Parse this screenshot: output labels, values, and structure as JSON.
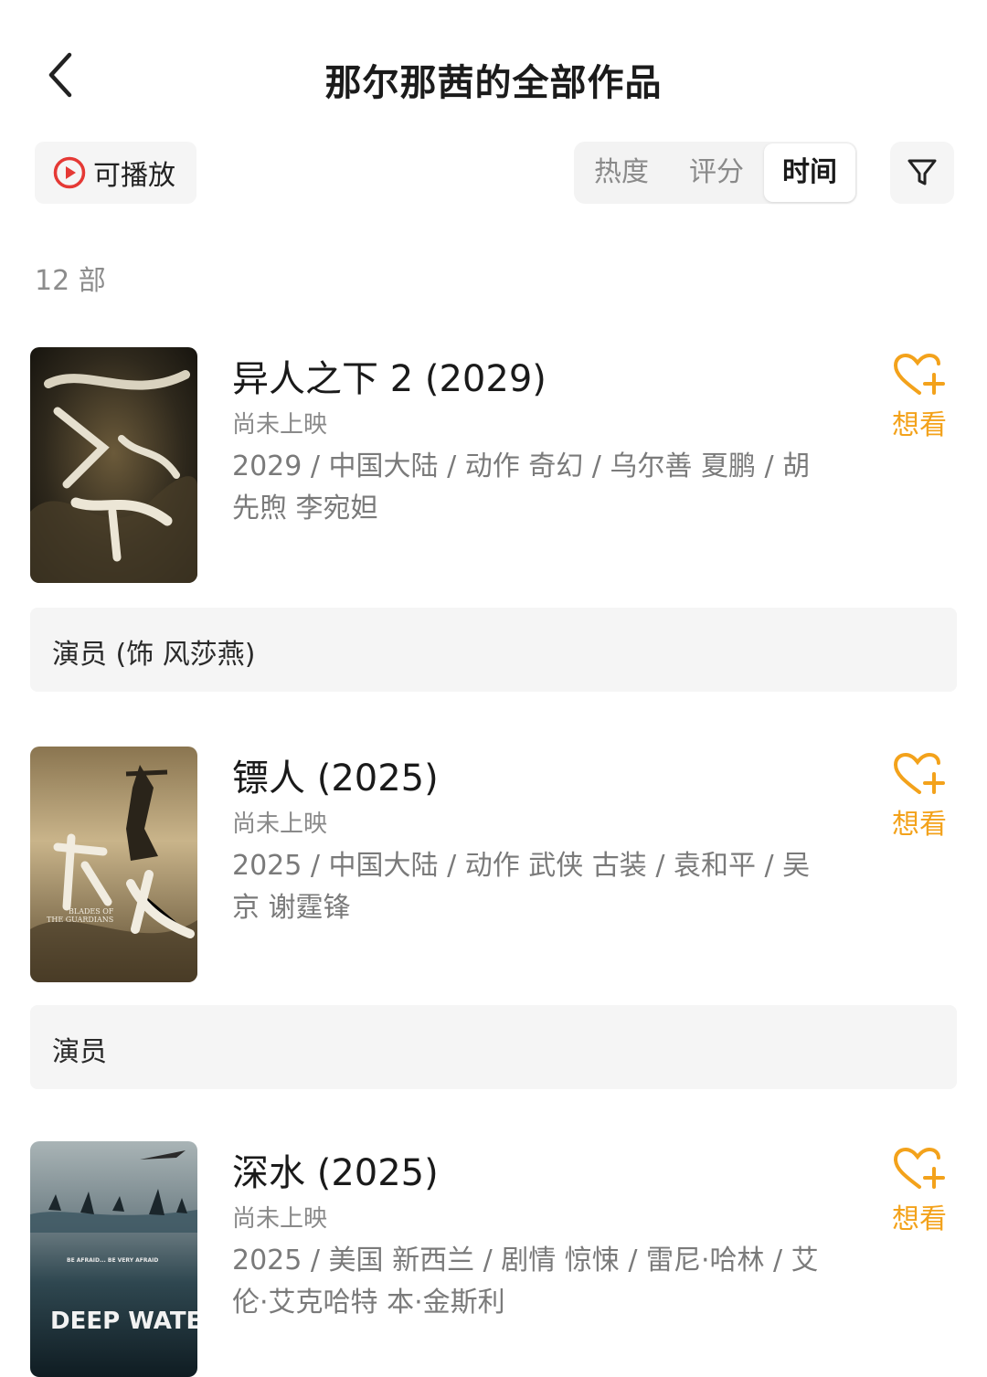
{
  "header": {
    "title": "那尔那茜的全部作品",
    "back_icon": "chevron-left-icon"
  },
  "filters": {
    "playable_label": "可播放",
    "playable_icon": "play-circle-icon",
    "sort_tabs": [
      {
        "label": "热度",
        "active": false
      },
      {
        "label": "评分",
        "active": false
      },
      {
        "label": "时间",
        "active": true
      }
    ],
    "filter_icon": "funnel-icon"
  },
  "count": "12 部",
  "colors": {
    "accent": "#f3a21b",
    "play_red": "#e53935"
  },
  "works": [
    {
      "title": "异人之下 2 (2029)",
      "status": "尚未上映",
      "meta": "2029 / 中国大陆 / 动作 奇幻 / 乌尔善 夏鹏 / 胡先煦 李宛妲",
      "wish_label": "想看",
      "wish_icon": "heart-plus-icon",
      "role": "演员 (饰 风莎燕)"
    },
    {
      "title": "镖人 (2025)",
      "status": "尚未上映",
      "meta": "2025 / 中国大陆 / 动作 武侠 古装 / 袁和平 / 吴京 谢霆锋",
      "wish_label": "想看",
      "wish_icon": "heart-plus-icon",
      "role": "演员",
      "poster_text": [
        "BLADES OF",
        "THE GUARDIANS"
      ]
    },
    {
      "title": "深水 (2025)",
      "status": "尚未上映",
      "meta": "2025 / 美国 新西兰 / 剧情 惊悚 / 雷尼·哈林 / 艾伦·艾克哈特 本·金斯利",
      "wish_label": "想看",
      "wish_icon": "heart-plus-icon",
      "poster_text": [
        "BE AFRAID... BE VERY AFRAID",
        "DEEP WATER"
      ]
    }
  ]
}
